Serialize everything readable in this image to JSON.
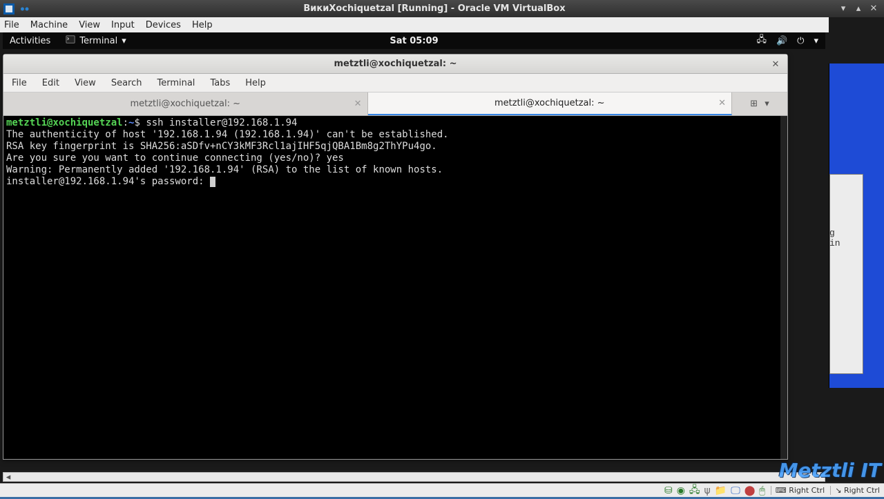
{
  "vm": {
    "title": "ВикиXochiquetzal [Running] - Oracle VM VirtualBox",
    "menu": {
      "file": "File",
      "machine": "Machine",
      "view": "View",
      "input": "Input",
      "devices": "Devices",
      "help": "Help"
    }
  },
  "gnome": {
    "activities": "Activities",
    "appmenu": "Terminal",
    "clock": "Sat 05:09"
  },
  "terminal": {
    "title": "metztli@xochiquetzal: ~",
    "menu": {
      "file": "File",
      "edit": "Edit",
      "view": "View",
      "search": "Search",
      "terminal": "Terminal",
      "tabs": "Tabs",
      "help": "Help"
    },
    "tabs": [
      {
        "label": "metztli@xochiquetzal: ~",
        "active": false
      },
      {
        "label": "metztli@xochiquetzal: ~",
        "active": true
      }
    ],
    "prompt_user": "metztli@xochiquetzal",
    "prompt_sep": ":",
    "prompt_path": "~",
    "prompt_sym": "$",
    "command": "ssh installer@192.168.1.94",
    "lines": {
      "l1": "The authenticity of host '192.168.1.94 (192.168.1.94)' can't be established.",
      "l2": "RSA key fingerprint is SHA256:aSDfv+nCY3kMF3Rcl1ajIHF5qjQBA1Bm8g2ThYPu4go.",
      "l3": "Are you sure you want to continue connecting (yes/no)? yes",
      "l4": "Warning: Permanently added '192.168.1.94' (RSA) to the list of known hosts.",
      "l5": "installer@192.168.1.94's password: "
    }
  },
  "bg_window": {
    "peek_text": "g in"
  },
  "statusbar": {
    "hostkey_left": "Right Ctrl",
    "hostkey_right": "Right Ctrl"
  },
  "watermark": "Metztli IT"
}
